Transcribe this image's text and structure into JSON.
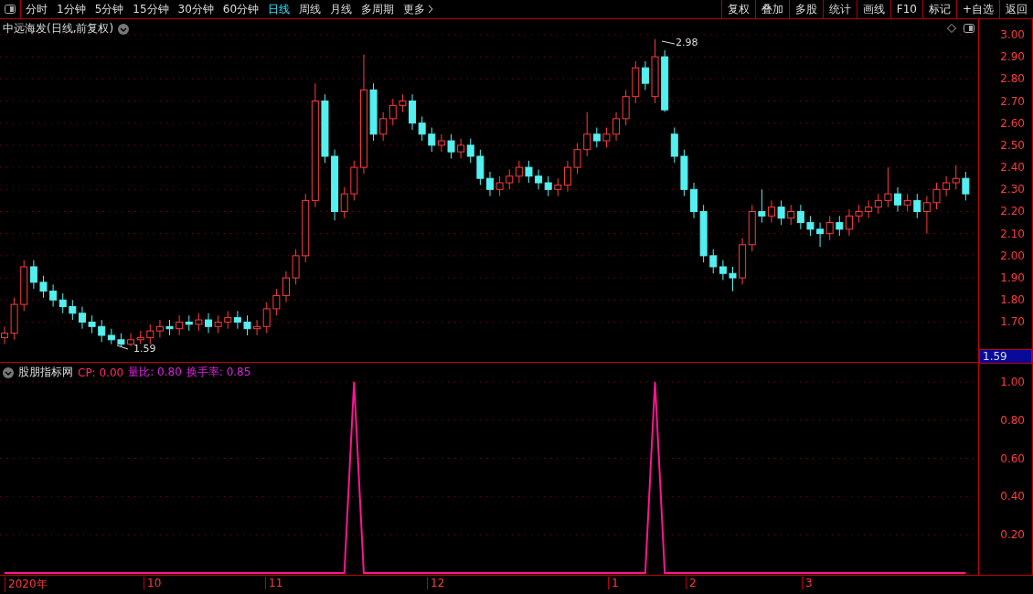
{
  "toolbar": {
    "periods": [
      {
        "label": "分时",
        "selected": false
      },
      {
        "label": "1分钟",
        "selected": false
      },
      {
        "label": "5分钟",
        "selected": false
      },
      {
        "label": "15分钟",
        "selected": false
      },
      {
        "label": "30分钟",
        "selected": false
      },
      {
        "label": "60分钟",
        "selected": false
      },
      {
        "label": "日线",
        "selected": true
      },
      {
        "label": "周线",
        "selected": false
      },
      {
        "label": "月线",
        "selected": false
      },
      {
        "label": "多周期",
        "selected": false
      },
      {
        "label": "更多",
        "selected": false
      }
    ],
    "buttons": [
      "复权",
      "叠加",
      "多股",
      "统计",
      "画线",
      "F10",
      "标记",
      "+自选",
      "返回"
    ]
  },
  "chart": {
    "title": "中远海发(日线,前复权)",
    "high_label": "2.98",
    "low_label": "1.59",
    "current_price": "1.59",
    "chart_data": {
      "type": "candlestick",
      "ylim": [
        1.52,
        3.07
      ],
      "grid": true,
      "yticks": [
        {
          "value": 3,
          "label": "3.00"
        },
        {
          "value": 2.9,
          "label": "2.90"
        },
        {
          "value": 2.8,
          "label": "2.80"
        },
        {
          "value": 2.7,
          "label": "2.70"
        },
        {
          "value": 2.6,
          "label": "2.60"
        },
        {
          "value": 2.5,
          "label": "2.50"
        },
        {
          "value": 2.4,
          "label": "2.40"
        },
        {
          "value": 2.3,
          "label": "2.30"
        },
        {
          "value": 2.2,
          "label": "2.20"
        },
        {
          "value": 2.1,
          "label": "2.10"
        },
        {
          "value": 2,
          "label": "2.00"
        },
        {
          "value": 1.9,
          "label": "1.90"
        },
        {
          "value": 1.8,
          "label": "1.80"
        },
        {
          "value": 1.7,
          "label": "1.70"
        }
      ],
      "ohlc": [
        [
          1.63,
          1.68,
          1.6,
          1.65
        ],
        [
          1.65,
          1.81,
          1.62,
          1.78
        ],
        [
          1.78,
          1.98,
          1.75,
          1.95
        ],
        [
          1.95,
          1.98,
          1.85,
          1.88
        ],
        [
          1.88,
          1.91,
          1.81,
          1.84
        ],
        [
          1.84,
          1.87,
          1.77,
          1.8
        ],
        [
          1.8,
          1.83,
          1.74,
          1.77
        ],
        [
          1.77,
          1.8,
          1.71,
          1.74
        ],
        [
          1.74,
          1.77,
          1.67,
          1.7
        ],
        [
          1.7,
          1.73,
          1.65,
          1.68
        ],
        [
          1.68,
          1.71,
          1.61,
          1.64
        ],
        [
          1.64,
          1.67,
          1.6,
          1.62
        ],
        [
          1.62,
          1.65,
          1.59,
          1.6
        ],
        [
          1.6,
          1.65,
          1.59,
          1.62
        ],
        [
          1.62,
          1.66,
          1.6,
          1.63
        ],
        [
          1.63,
          1.69,
          1.6,
          1.66
        ],
        [
          1.66,
          1.71,
          1.63,
          1.68
        ],
        [
          1.68,
          1.71,
          1.64,
          1.67
        ],
        [
          1.67,
          1.73,
          1.64,
          1.7
        ],
        [
          1.7,
          1.73,
          1.66,
          1.69
        ],
        [
          1.69,
          1.74,
          1.66,
          1.71
        ],
        [
          1.71,
          1.74,
          1.65,
          1.68
        ],
        [
          1.68,
          1.73,
          1.65,
          1.7
        ],
        [
          1.7,
          1.75,
          1.67,
          1.72
        ],
        [
          1.72,
          1.75,
          1.67,
          1.7
        ],
        [
          1.7,
          1.73,
          1.64,
          1.67
        ],
        [
          1.67,
          1.71,
          1.64,
          1.68
        ],
        [
          1.68,
          1.79,
          1.65,
          1.76
        ],
        [
          1.76,
          1.85,
          1.73,
          1.82
        ],
        [
          1.82,
          1.93,
          1.79,
          1.9
        ],
        [
          1.9,
          2.03,
          1.87,
          2.0
        ],
        [
          2.0,
          2.28,
          1.97,
          2.25
        ],
        [
          2.25,
          2.78,
          2.22,
          2.7
        ],
        [
          2.7,
          2.73,
          2.42,
          2.45
        ],
        [
          2.45,
          2.48,
          2.16,
          2.2
        ],
        [
          2.2,
          2.31,
          2.17,
          2.28
        ],
        [
          2.28,
          2.43,
          2.25,
          2.4
        ],
        [
          2.4,
          2.91,
          2.37,
          2.75
        ],
        [
          2.75,
          2.78,
          2.52,
          2.55
        ],
        [
          2.55,
          2.65,
          2.52,
          2.62
        ],
        [
          2.62,
          2.71,
          2.59,
          2.68
        ],
        [
          2.68,
          2.73,
          2.65,
          2.7
        ],
        [
          2.7,
          2.73,
          2.57,
          2.6
        ],
        [
          2.6,
          2.63,
          2.52,
          2.55
        ],
        [
          2.55,
          2.58,
          2.47,
          2.5
        ],
        [
          2.5,
          2.55,
          2.47,
          2.52
        ],
        [
          2.52,
          2.55,
          2.44,
          2.47
        ],
        [
          2.47,
          2.53,
          2.44,
          2.5
        ],
        [
          2.5,
          2.53,
          2.42,
          2.45
        ],
        [
          2.45,
          2.48,
          2.32,
          2.35
        ],
        [
          2.35,
          2.38,
          2.27,
          2.3
        ],
        [
          2.3,
          2.36,
          2.27,
          2.33
        ],
        [
          2.33,
          2.39,
          2.3,
          2.36
        ],
        [
          2.36,
          2.43,
          2.33,
          2.4
        ],
        [
          2.4,
          2.43,
          2.33,
          2.36
        ],
        [
          2.36,
          2.39,
          2.3,
          2.33
        ],
        [
          2.33,
          2.36,
          2.27,
          2.3
        ],
        [
          2.3,
          2.35,
          2.27,
          2.32
        ],
        [
          2.32,
          2.43,
          2.29,
          2.4
        ],
        [
          2.4,
          2.51,
          2.37,
          2.48
        ],
        [
          2.48,
          2.65,
          2.45,
          2.55
        ],
        [
          2.55,
          2.58,
          2.49,
          2.52
        ],
        [
          2.52,
          2.58,
          2.49,
          2.55
        ],
        [
          2.55,
          2.65,
          2.52,
          2.62
        ],
        [
          2.62,
          2.75,
          2.59,
          2.72
        ],
        [
          2.72,
          2.88,
          2.69,
          2.85
        ],
        [
          2.85,
          2.88,
          2.75,
          2.78
        ],
        [
          2.72,
          2.98,
          2.69,
          2.9
        ],
        [
          2.9,
          2.93,
          2.65,
          2.66
        ],
        [
          2.55,
          2.58,
          2.42,
          2.45
        ],
        [
          2.45,
          2.48,
          2.27,
          2.3
        ],
        [
          2.3,
          2.33,
          2.17,
          2.2
        ],
        [
          2.2,
          2.23,
          1.97,
          2.0
        ],
        [
          2.0,
          2.03,
          1.92,
          1.95
        ],
        [
          1.95,
          1.98,
          1.89,
          1.92
        ],
        [
          1.92,
          1.95,
          1.84,
          1.9
        ],
        [
          1.9,
          2.08,
          1.87,
          2.05
        ],
        [
          2.05,
          2.23,
          2.02,
          2.2
        ],
        [
          2.2,
          2.3,
          2.15,
          2.18
        ],
        [
          2.18,
          2.25,
          2.15,
          2.22
        ],
        [
          2.22,
          2.25,
          2.14,
          2.17
        ],
        [
          2.17,
          2.23,
          2.14,
          2.2
        ],
        [
          2.2,
          2.23,
          2.12,
          2.15
        ],
        [
          2.15,
          2.18,
          2.09,
          2.12
        ],
        [
          2.12,
          2.15,
          2.04,
          2.1
        ],
        [
          2.1,
          2.18,
          2.07,
          2.15
        ],
        [
          2.15,
          2.18,
          2.09,
          2.12
        ],
        [
          2.12,
          2.21,
          2.09,
          2.18
        ],
        [
          2.18,
          2.23,
          2.15,
          2.2
        ],
        [
          2.2,
          2.25,
          2.17,
          2.22
        ],
        [
          2.22,
          2.28,
          2.19,
          2.25
        ],
        [
          2.25,
          2.4,
          2.22,
          2.28
        ],
        [
          2.28,
          2.31,
          2.2,
          2.23
        ],
        [
          2.23,
          2.28,
          2.2,
          2.25
        ],
        [
          2.25,
          2.28,
          2.17,
          2.2
        ],
        [
          2.2,
          2.27,
          2.1,
          2.24
        ],
        [
          2.24,
          2.33,
          2.21,
          2.3
        ],
        [
          2.3,
          2.36,
          2.27,
          2.33
        ],
        [
          2.33,
          2.41,
          2.3,
          2.35
        ],
        [
          2.35,
          2.38,
          2.25,
          2.28
        ]
      ]
    }
  },
  "indicator": {
    "name": "股朋指标网",
    "readings": [
      {
        "text": "CP: 0.00",
        "color": "#ff2a6a"
      },
      {
        "text": "量比: 0.80",
        "color": "#e020e0"
      },
      {
        "text": "换手率: 0.85",
        "color": "#e020e0"
      }
    ],
    "chart_data": {
      "type": "line",
      "ylim": [
        -0.01,
        1.1
      ],
      "grid": true,
      "yticks": [
        {
          "value": 1,
          "label": "1.00"
        },
        {
          "value": 0.8,
          "label": "0.80"
        },
        {
          "value": 0.6,
          "label": "0.60"
        },
        {
          "value": 0.4,
          "label": "0.40"
        },
        {
          "value": 0.2,
          "label": "0.20"
        }
      ],
      "series": [
        {
          "color": "#ff1493",
          "values": [
            0,
            0,
            0,
            0,
            0,
            0,
            0,
            0,
            0,
            0,
            0,
            0,
            0,
            0,
            0,
            0,
            0,
            0,
            0,
            0,
            0,
            0,
            0,
            0,
            0,
            0,
            0,
            0,
            0,
            0,
            0,
            0,
            0,
            0,
            0,
            0,
            1,
            0,
            0,
            0,
            0,
            0,
            0,
            0,
            0,
            0,
            0,
            0,
            0,
            0,
            0,
            0,
            0,
            0,
            0,
            0,
            0,
            0,
            0,
            0,
            0,
            0,
            0,
            0,
            0,
            0,
            0,
            1,
            0,
            0,
            0,
            0,
            0,
            0,
            0,
            0,
            0,
            0,
            0,
            0,
            0,
            0,
            0,
            0,
            0,
            0,
            0,
            0,
            0,
            0,
            0,
            0,
            0,
            0,
            0,
            0,
            0,
            0,
            0,
            0
          ]
        }
      ]
    }
  },
  "date_axis": [
    "2020年",
    "10",
    "11",
    "12",
    "1",
    "2",
    "3"
  ]
}
